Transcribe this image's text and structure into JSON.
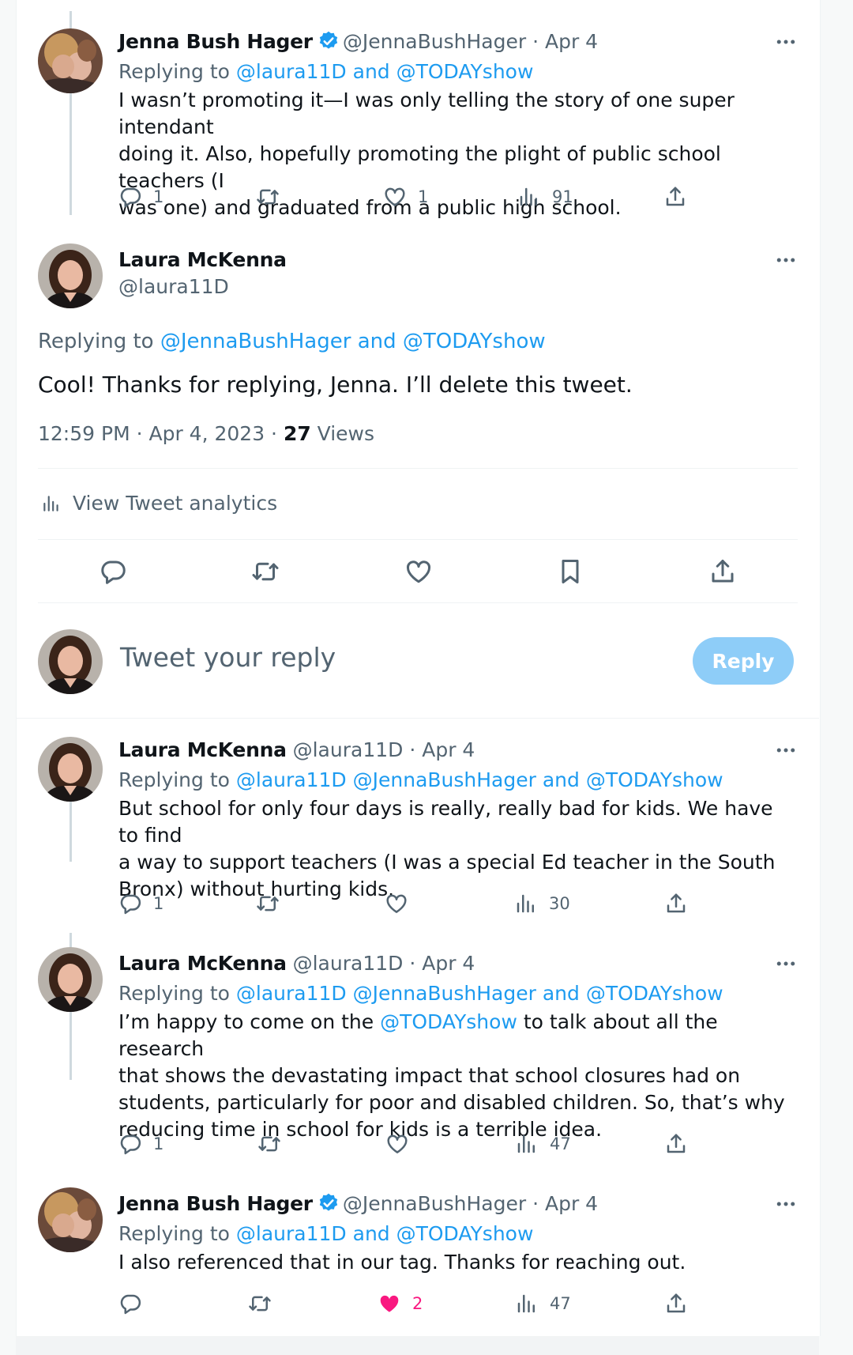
{
  "colors": {
    "accent": "#1d9bf0",
    "text": "#0f1419",
    "muted": "#536471",
    "like_active": "#f91880",
    "reply_button_bg": "#8ecdf8"
  },
  "tweets": [
    {
      "name": "Jenna Bush Hager",
      "verified": true,
      "handle": "@JennaBushHager",
      "date": "· Apr 4",
      "replying_prefix": "Replying to",
      "replying_mentions": "@laura11D and @TODAYshow",
      "text": [
        "I wasn’t promoting it—I was only telling the story of one super intendant",
        "doing it. Also, hopefully promoting the plight of public school teachers (I",
        "was one) and graduated from a public high school."
      ],
      "replies": "1",
      "retweets": "",
      "likes": "1",
      "views": "91"
    },
    {
      "name": "Laura McKenna",
      "verified": false,
      "handle": "@laura11D",
      "date": "· Apr 4",
      "replying_prefix": "Replying to",
      "replying_mentions": "@laura11D @JennaBushHager and @TODAYshow",
      "text": [
        "But school for only four days is really, really bad for kids. We have to find",
        "a way to support teachers (I was a special Ed teacher in the South",
        "Bronx) without hurting kids."
      ],
      "replies": "1",
      "retweets": "",
      "likes": "",
      "views": "30"
    },
    {
      "name": "Laura McKenna",
      "verified": false,
      "handle": "@laura11D",
      "date": "· Apr 4",
      "replying_prefix": "Replying to",
      "replying_mentions": "@laura11D @JennaBushHager and @TODAYshow",
      "text_line1_before": "I’m happy to come on the ",
      "text_line1_link": "@TODAYshow",
      "text_line1_after": " to talk about all the research",
      "text": [
        "that shows the devastating impact that school closures had on",
        "students, particularly for poor and disabled children. So, that’s why",
        "reducing time in school for kids is a terrible idea."
      ],
      "replies": "1",
      "retweets": "",
      "likes": "",
      "views": "47"
    },
    {
      "name": "Jenna Bush Hager",
      "verified": true,
      "handle": "@JennaBushHager",
      "date": "· Apr 4",
      "replying_prefix": "Replying to",
      "replying_mentions": "@laura11D and @TODAYshow",
      "text": [
        "I also referenced that in our tag. Thanks for reaching out."
      ],
      "replies": "",
      "retweets": "",
      "likes": "2",
      "views": "47"
    }
  ],
  "focused": {
    "name": "Laura McKenna",
    "handle": "@laura11D",
    "replying_prefix": "Replying to",
    "replying_mentions": "@JennaBushHager and @TODAYshow",
    "text": "Cool! Thanks for replying, Jenna. I’ll delete this tweet.",
    "timestamp": "12:59 PM · Apr 4, 2023 · ",
    "views_count": "27",
    "views_label": " Views",
    "analytics_label": "View Tweet analytics"
  },
  "compose": {
    "placeholder": "Tweet your reply",
    "button_label": "Reply"
  },
  "icons": {
    "reply": "reply-icon",
    "retweet": "retweet-icon",
    "like": "heart-icon",
    "views": "views-icon",
    "share": "share-icon",
    "bookmark": "bookmark-icon",
    "more": "more-icon",
    "verified": "verified-badge-icon"
  }
}
